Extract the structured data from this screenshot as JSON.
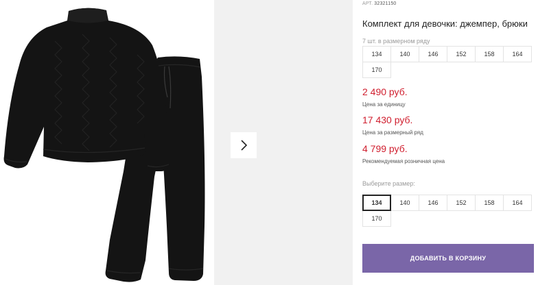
{
  "product": {
    "article_label": "АРТ.",
    "article_number": "32321150",
    "title": "Комплект для девочки: джемпер, брюки"
  },
  "pack": {
    "label": "7 шт. в размерном ряду",
    "sizes": [
      "134",
      "140",
      "146",
      "152",
      "158",
      "164",
      "170"
    ]
  },
  "prices": {
    "unit_price": "2 490 руб.",
    "unit_note": "Цена за единицу",
    "pack_price": "17 430 руб.",
    "pack_note": "Цена за размерный ряд",
    "retail_price": "4 799 руб.",
    "retail_note": "Рекомендуемая розничная цена"
  },
  "size_picker": {
    "label": "Выберите размер:",
    "sizes": [
      "134",
      "140",
      "146",
      "152",
      "158",
      "164",
      "170"
    ],
    "selected": "134"
  },
  "cart": {
    "button_label": "ДОБАВИТЬ В КОРЗИНУ"
  },
  "gallery": {
    "next_icon": "chevron-right-icon"
  },
  "colors": {
    "price": "#d01e2e",
    "button": "#7a66a8",
    "garment": "#141414",
    "next_photo_bg": "#f1f1f1"
  }
}
